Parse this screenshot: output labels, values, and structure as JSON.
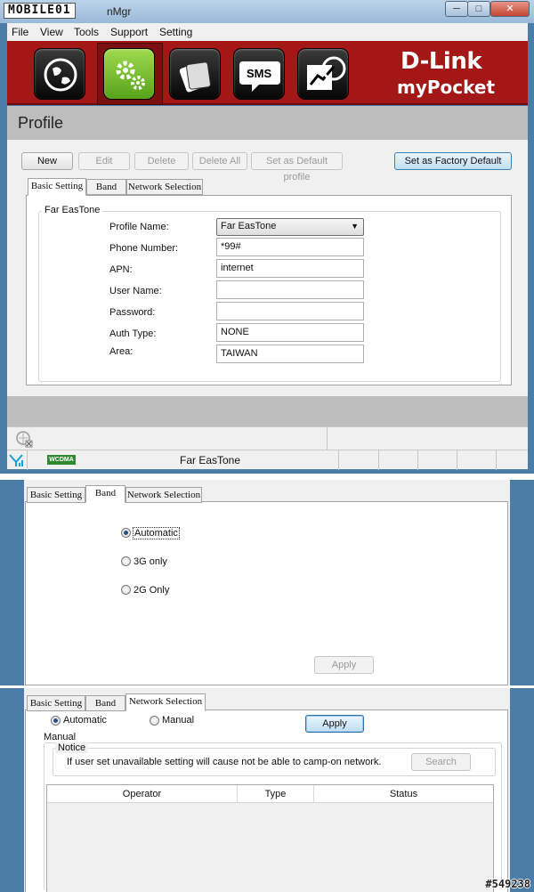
{
  "window": {
    "logo_text": "MOBILE01",
    "title": "nMgr",
    "min_label": "─",
    "max_label": "□",
    "close_label": "✕"
  },
  "menu": [
    "File",
    "View",
    "Tools",
    "Support",
    "Setting"
  ],
  "toolbar": {
    "icons": [
      "internet-icon",
      "settings-icon",
      "phonebook-icon",
      "sms-icon",
      "statistics-icon"
    ],
    "sms_label": "SMS",
    "active_index": 1,
    "brand_line1": "D-Link",
    "brand_line2": "myPocket",
    "brand_color": "#a31717",
    "active_color": "#6cb52a"
  },
  "profile": {
    "heading": "Profile",
    "buttons": {
      "new": "New",
      "edit": "Edit",
      "delete": "Delete",
      "delete_all": "Delete All",
      "set_default": "Set as Default profile",
      "factory_default": "Set as Factory Default"
    },
    "tabs": [
      "Basic Setting",
      "Band",
      "Network Selection"
    ],
    "group_title": "Far EasTone",
    "fields": {
      "profile_name_label": "Profile Name:",
      "profile_name_value": "Far EasTone",
      "phone_label": "Phone Number:",
      "phone_value": "*99#",
      "apn_label": "APN:",
      "apn_value": "internet",
      "user_label": "User Name:",
      "user_value": "",
      "password_label": "Password:",
      "password_value": "",
      "auth_label": "Auth Type:",
      "auth_value": "NONE",
      "area_label": "Area:",
      "area_value": "TAIWAN"
    }
  },
  "statusbar": {
    "network_type": "WCDMA",
    "operator": "Far EasTone"
  },
  "band": {
    "options": [
      "Automatic",
      "3G only",
      "2G Only"
    ],
    "selected": "Automatic",
    "apply": "Apply"
  },
  "network": {
    "mode_automatic": "Automatic",
    "mode_manual": "Manual",
    "selected_mode": "Automatic",
    "apply": "Apply",
    "manual_group": "Manual",
    "notice_group": "Notice",
    "notice_text": "If user set unavailable setting will cause  not be able to camp-on network.",
    "search": "Search",
    "columns": [
      "Operator",
      "Type",
      "Status"
    ]
  },
  "watermark": "#549238"
}
